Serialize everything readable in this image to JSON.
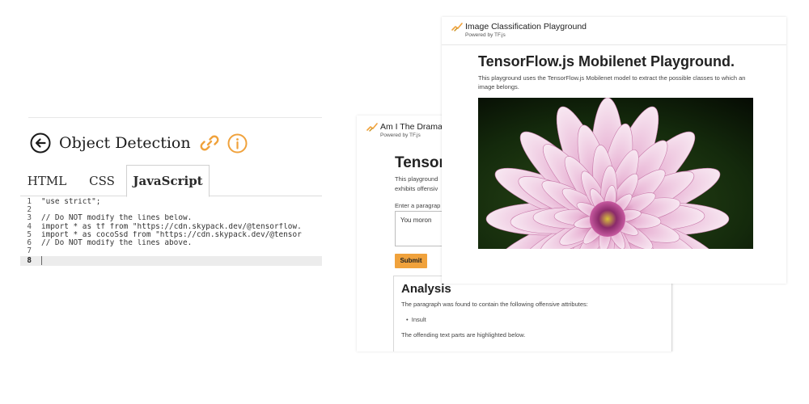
{
  "editor": {
    "title": "Object Detection",
    "tabs": [
      "HTML",
      "CSS",
      "JavaScript"
    ],
    "active_tab": "JavaScript",
    "lines": [
      {
        "num": "1",
        "parts": [
          {
            "t": "\"use strict\"",
            "c": "str"
          },
          {
            "t": ";",
            "c": ""
          }
        ]
      },
      {
        "num": "2",
        "parts": []
      },
      {
        "num": "3",
        "parts": [
          {
            "t": "// Do NOT modify the lines below.",
            "c": "cm"
          }
        ]
      },
      {
        "num": "4",
        "parts": [
          {
            "t": "import",
            "c": "kw"
          },
          {
            "t": " * as tf from ",
            "c": ""
          },
          {
            "t": "\"https://cdn.skypack.dev/@tensorflow.",
            "c": ""
          }
        ]
      },
      {
        "num": "5",
        "parts": [
          {
            "t": "import",
            "c": "kw"
          },
          {
            "t": " * as cocoSsd from ",
            "c": ""
          },
          {
            "t": "\"https://cdn.skypack.dev/@tensor",
            "c": ""
          }
        ]
      },
      {
        "num": "6",
        "parts": [
          {
            "t": "// Do NOT modify the lines above.",
            "c": "cm"
          }
        ]
      },
      {
        "num": "7",
        "parts": []
      },
      {
        "num": "8",
        "parts": [],
        "active": true
      }
    ],
    "icons": {
      "back": "back-arrow-circle-icon",
      "link": "link-icon",
      "info": "info-circle-icon"
    },
    "accent_color": "#f0a23c"
  },
  "drama_window": {
    "app_name": "Am I The Drama",
    "powered_by": "Powered by TF.js",
    "heading": "TensorF",
    "description": "This playground",
    "description_line2": "exhibits offensiv",
    "input_label": "Enter a paragrap",
    "input_value": "You moron",
    "submit_label": "Submit",
    "analysis_heading": "Analysis",
    "found_text": "The paragraph was found to contain the following offensive attributes:",
    "attributes": [
      "Insult"
    ],
    "offending_text": "The offending text parts are highlighted below.",
    "button_color": "#f0a23c"
  },
  "classification_window": {
    "app_name": "Image Classification Playground",
    "powered_by": "Powered by TF.js",
    "heading": "TensorFlow.js Mobilenet Playground.",
    "description": "This playground uses the TensorFlow.js Mobilenet model to extract the possible classes to which an image belongs.",
    "image_subject": "pink-dahlia-flower-image"
  }
}
